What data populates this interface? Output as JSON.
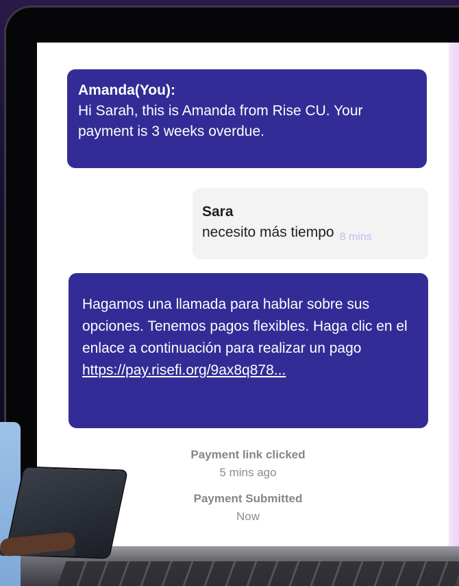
{
  "messages": [
    {
      "sender": "Amanda(You):",
      "text": "Hi Sarah, this is Amanda from Rise CU. Your payment is 3 weeks overdue."
    },
    {
      "sender": "Sara",
      "text": "necesito más tiempo",
      "time": "8 mins"
    },
    {
      "text": "Hagamos una llamada para hablar sobre sus opciones. Tenemos pagos flexibles. Haga clic en el enlace a continuación para realizar un pago",
      "link": "https://pay.risefi.org/9ax8q878..."
    }
  ],
  "events": [
    {
      "label": "Payment link clicked",
      "when": "5 mins ago"
    },
    {
      "label": "Payment Submitted",
      "when": "Now"
    }
  ],
  "colors": {
    "outgoing_bubble": "#332c96",
    "incoming_bubble": "#f3f3f4",
    "timestamp": "#cdb7f2",
    "event_text": "#8a8a8e"
  }
}
